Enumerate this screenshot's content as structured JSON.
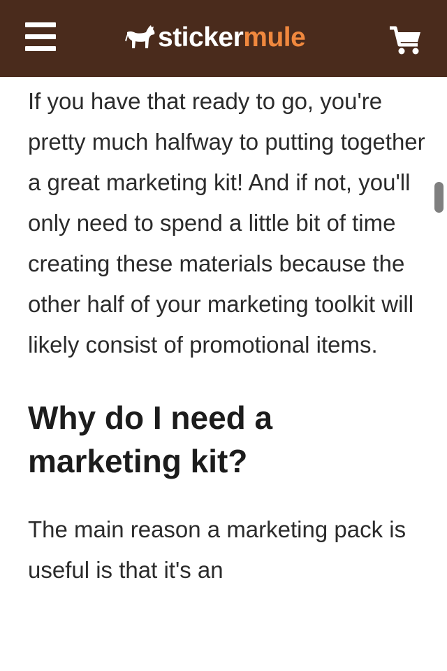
{
  "header": {
    "brand_part1": "sticker",
    "brand_part2": "mule",
    "menu_icon": "hamburger-menu-icon",
    "cart_icon": "shopping-cart-icon",
    "background_color": "#4a2b1c",
    "accent_color": "#f0883e"
  },
  "article": {
    "paragraph1": "If you have that ready to go, you're pretty much halfway to putting together a great marketing kit! And if not, you'll only need to spend a little bit of time creating these materials because the other half of your marketing toolkit will likely consist of promotional items.",
    "heading": "Why do I need a marketing kit?",
    "paragraph2": "The main reason a marketing pack is useful is that it's an"
  }
}
